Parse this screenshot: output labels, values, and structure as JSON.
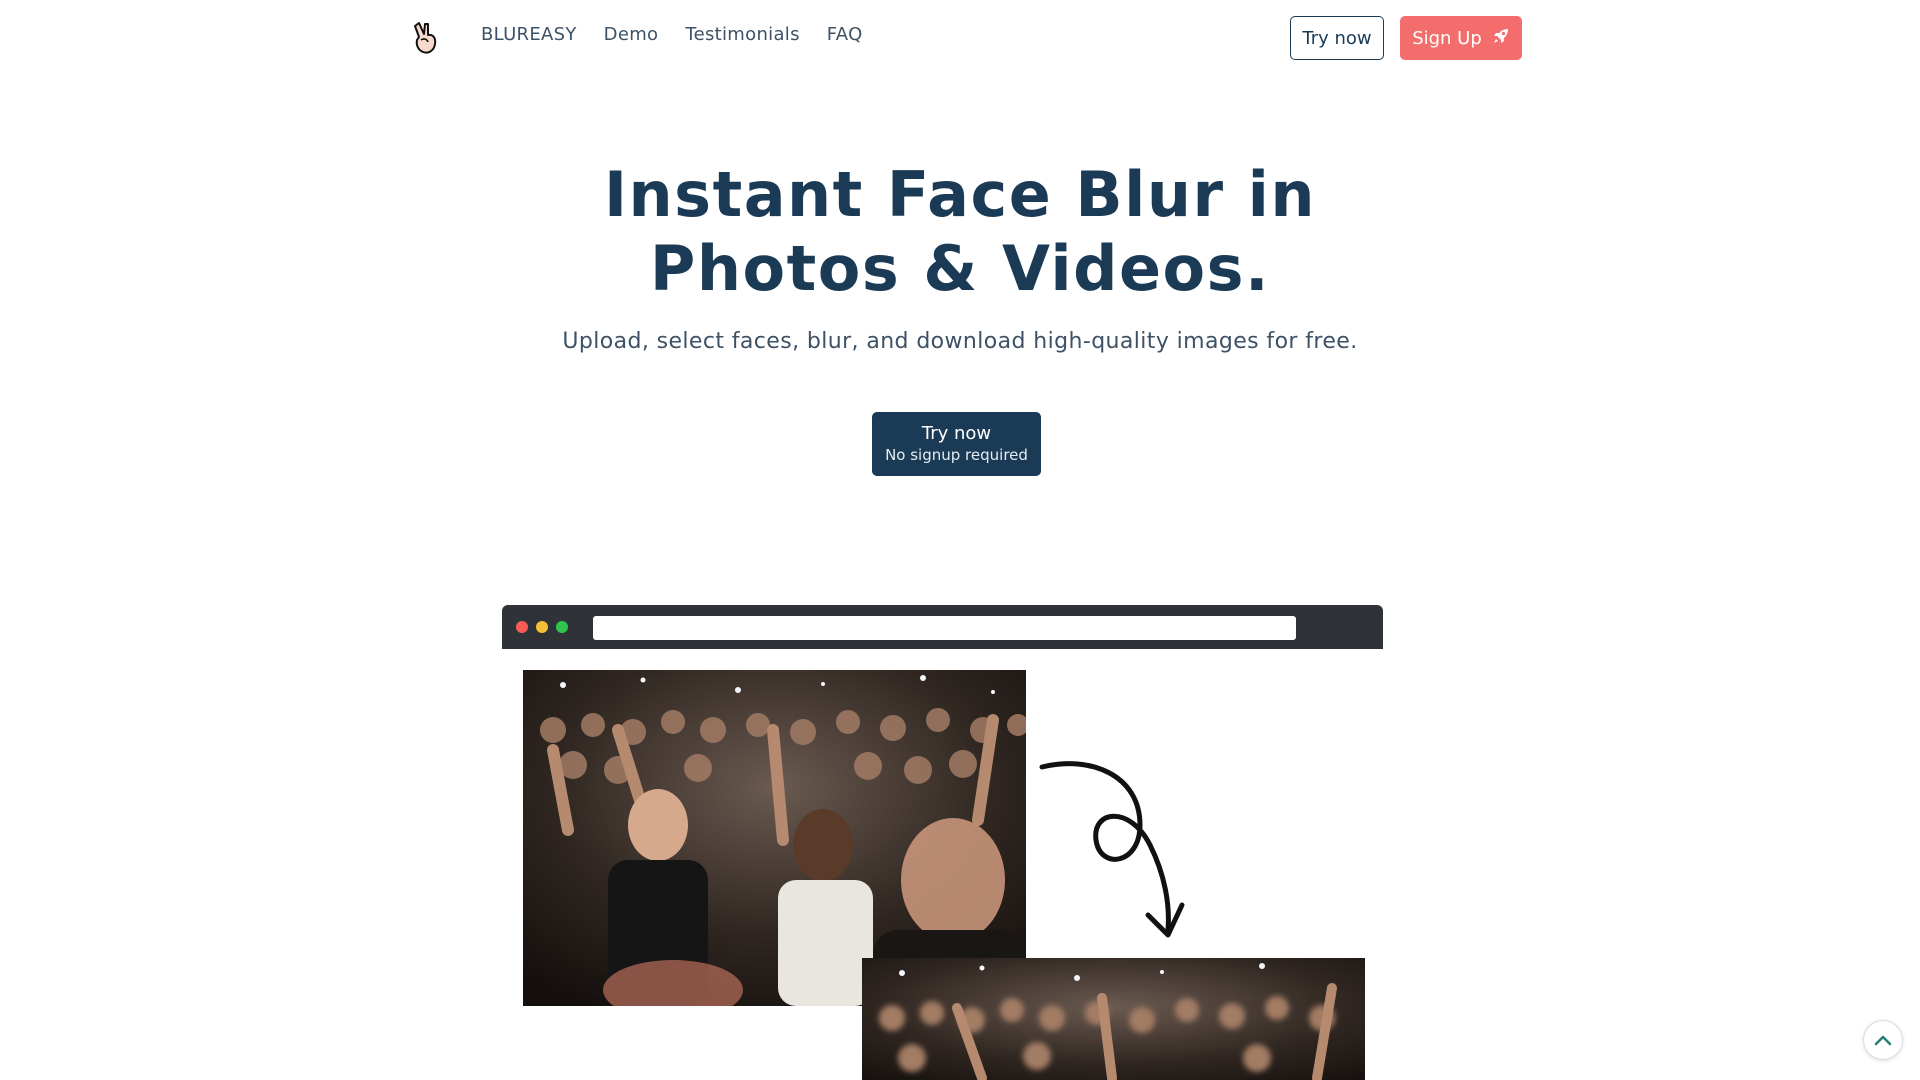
{
  "nav": {
    "logo_icon": "peace-hand-icon",
    "links": [
      {
        "label": "BLUREASY"
      },
      {
        "label": "Demo"
      },
      {
        "label": "Testimonials"
      },
      {
        "label": "FAQ"
      }
    ],
    "try_now_label": "Try now",
    "signup_label": "Sign Up",
    "signup_icon": "rocket-icon"
  },
  "hero": {
    "title_line1": "Instant Face Blur in",
    "title_line2": "Photos & Videos.",
    "subtitle": "Upload, select faces, blur, and download high-quality images for free.",
    "cta_label": "Try now",
    "cta_sublabel": "No signup required"
  },
  "demo": {
    "window_dots": [
      "#fb5b55",
      "#f4bf37",
      "#2fc64b"
    ],
    "arrow_icon": "curly-arrow-icon"
  },
  "colors": {
    "primary": "#1b3a55",
    "accent": "#f46d6d",
    "browser_bar": "#2f3337"
  },
  "scroll_top_icon": "chevron-up-icon"
}
